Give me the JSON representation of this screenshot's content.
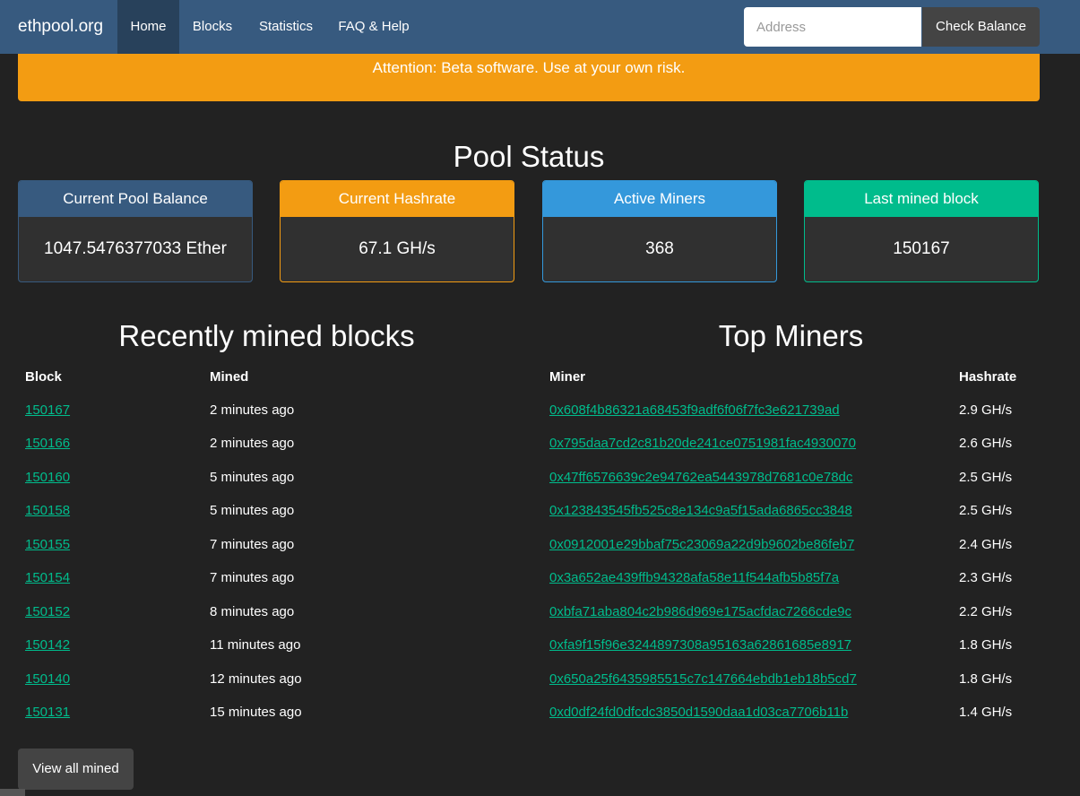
{
  "navbar": {
    "brand": "ethpool.org",
    "items": [
      {
        "label": "Home",
        "active": true
      },
      {
        "label": "Blocks",
        "active": false
      },
      {
        "label": "Statistics",
        "active": false
      },
      {
        "label": "FAQ & Help",
        "active": false
      }
    ],
    "address_placeholder": "Address",
    "check_balance_label": "Check Balance"
  },
  "alert": "Attention: Beta software. Use at your own risk.",
  "pool_status": {
    "title": "Pool Status",
    "panels": [
      {
        "heading": "Current Pool Balance",
        "value": "1047.5476377033 Ether",
        "color": "#375a7f"
      },
      {
        "heading": "Current Hashrate",
        "value": "67.1 GH/s",
        "color": "#f39c12"
      },
      {
        "heading": "Active Miners",
        "value": "368",
        "color": "#3498db"
      },
      {
        "heading": "Last mined block",
        "value": "150167",
        "color": "#00bc8c"
      }
    ]
  },
  "recent_blocks": {
    "title": "Recently mined blocks",
    "headers": {
      "block": "Block",
      "mined": "Mined"
    },
    "rows": [
      {
        "block": "150167",
        "mined": "2 minutes ago"
      },
      {
        "block": "150166",
        "mined": "2 minutes ago"
      },
      {
        "block": "150160",
        "mined": "5 minutes ago"
      },
      {
        "block": "150158",
        "mined": "5 minutes ago"
      },
      {
        "block": "150155",
        "mined": "7 minutes ago"
      },
      {
        "block": "150154",
        "mined": "7 minutes ago"
      },
      {
        "block": "150152",
        "mined": "8 minutes ago"
      },
      {
        "block": "150142",
        "mined": "11 minutes ago"
      },
      {
        "block": "150140",
        "mined": "12 minutes ago"
      },
      {
        "block": "150131",
        "mined": "15 minutes ago"
      }
    ],
    "view_all_label": "View all mined"
  },
  "top_miners": {
    "title": "Top Miners",
    "headers": {
      "miner": "Miner",
      "hashrate": "Hashrate"
    },
    "rows": [
      {
        "miner": "0x608f4b86321a68453f9adf6f06f7fc3e621739ad",
        "hashrate": "2.9 GH/s"
      },
      {
        "miner": "0x795daa7cd2c81b20de241ce0751981fac4930070",
        "hashrate": "2.6 GH/s"
      },
      {
        "miner": "0x47ff6576639c2e94762ea5443978d7681c0e78dc",
        "hashrate": "2.5 GH/s"
      },
      {
        "miner": "0x123843545fb525c8e134c9a5f15ada6865cc3848",
        "hashrate": "2.5 GH/s"
      },
      {
        "miner": "0x0912001e29bbaf75c23069a22d9b9602be86feb7",
        "hashrate": "2.4 GH/s"
      },
      {
        "miner": "0x3a652ae439ffb94328afa58e11f544afb5b85f7a",
        "hashrate": "2.3 GH/s"
      },
      {
        "miner": "0xbfa71aba804c2b986d969e175acfdac7266cde9c",
        "hashrate": "2.2 GH/s"
      },
      {
        "miner": "0xfa9f15f96e3244897308a95163a62861685e8917",
        "hashrate": "1.8 GH/s"
      },
      {
        "miner": "0x650a25f6435985515c7c147664ebdb1eb18b5cd7",
        "hashrate": "1.8 GH/s"
      },
      {
        "miner": "0xd0df24fd0dfcdc3850d1590daa1d03ca7706b11b",
        "hashrate": "1.4 GH/s"
      }
    ]
  },
  "colors": {
    "background": "#222222",
    "navbar": "#375a7f",
    "warning": "#f39c12",
    "info": "#3498db",
    "success": "#00bc8c",
    "link": "#00bc8c"
  }
}
